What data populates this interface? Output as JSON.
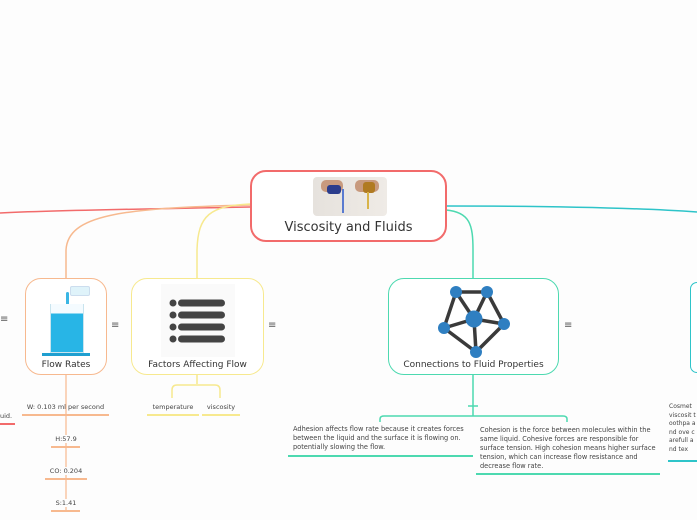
{
  "central": {
    "title": "Viscosity and Fluids",
    "image": "pouring-liquids-photo",
    "color": "#f26b6b"
  },
  "left_partial": {
    "text": "uid.",
    "color": "#f26b6b"
  },
  "topics": [
    {
      "title": "Flow Rates",
      "icon": "beaker-photo",
      "color": "#f7b98f",
      "children": [
        "W: 0.103 ml per second",
        "H:57.9",
        "CO: 0.204",
        "S:1.41"
      ]
    },
    {
      "title": "Factors Affecting Flow",
      "icon": "list-icon",
      "color": "#f7e98f",
      "children": [
        "temperature",
        "viscosity"
      ]
    },
    {
      "title": "Connections to Fluid Properties",
      "icon": "network-icon",
      "color": "#4dd9b0",
      "children": [
        "Adhesion affects flow rate because it creates forces between the liquid and the surface it is flowing on. potentially slowing the flow.",
        "Cohesion is the force between molecules within the same liquid. Cohesive forces are responsible for surface tension. High cohesion means higher surface tension, which can increase flow resistance and decrease flow rate."
      ]
    },
    {
      "title": "",
      "color": "#2ec4c9",
      "children": [
        "Cosmet viscosit toothpa and ove carefull and tex"
      ]
    }
  ],
  "menu_icon": "≡"
}
